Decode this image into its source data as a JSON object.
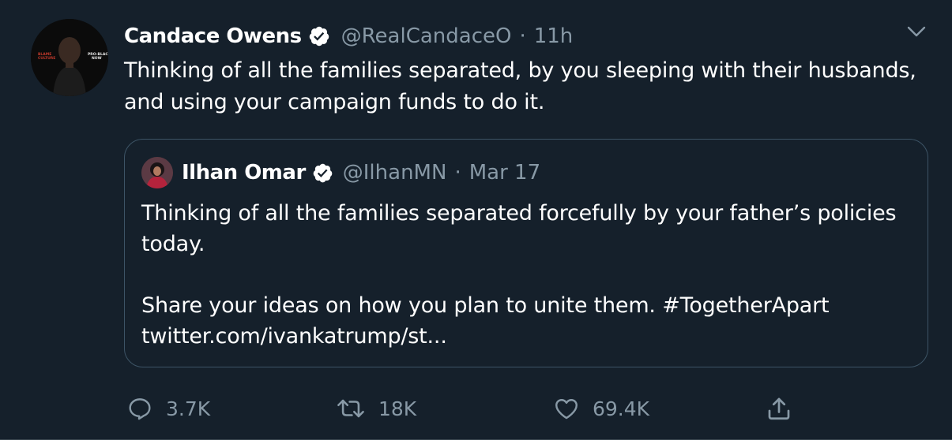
{
  "tweet": {
    "author_name": "Candace Owens",
    "author_handle": "@RealCandaceO",
    "separator": "·",
    "time": "11h",
    "text": "Thinking of all the families separated, by you sleeping with their husbands, and using your campaign funds to do it.",
    "avatar_badges": [
      "BLAME CULTURE",
      "PRO-BLACK NOW"
    ]
  },
  "quoted": {
    "author_name": "Ilhan Omar",
    "author_handle": "@IlhanMN",
    "separator": "·",
    "time": "Mar 17",
    "paragraph1": "Thinking of all the families separated forcefully by your father’s policies today.",
    "paragraph2": "Share your ideas on how you plan to unite them. #TogetherApart twitter.com/ivankatrump/st..."
  },
  "actions": {
    "reply_count": "3.7K",
    "retweet_count": "18K",
    "like_count": "69.4K"
  },
  "colors": {
    "background": "#15202b",
    "secondary_text": "#8899a6",
    "border": "#3d5466",
    "verified_badge": "#ffffff"
  },
  "icons": {
    "verified": "verified-icon",
    "caret": "chevron-down-icon",
    "reply": "reply-icon",
    "retweet": "retweet-icon",
    "like": "heart-icon",
    "share": "share-icon"
  }
}
